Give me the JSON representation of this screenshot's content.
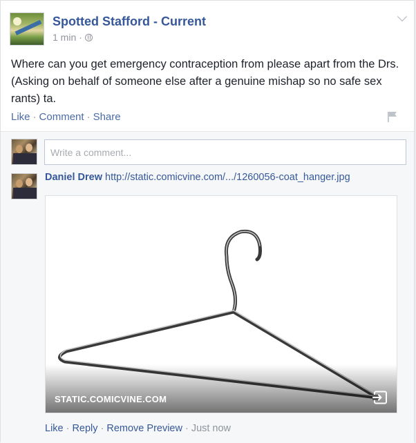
{
  "post": {
    "page_name": "Spotted Stafford - Current",
    "time": "1 min",
    "separator": "·",
    "body": "Where can you get emergency contraception from please apart from the Drs. (Asking on behalf of someone else after a genuine mishap so no safe sex rants) ta.",
    "actions": {
      "like": "Like",
      "comment": "Comment",
      "share": "Share",
      "sep": "·"
    },
    "icons": {
      "privacy": "globe-icon",
      "menu": "chevron-down-icon",
      "report": "flag-icon"
    }
  },
  "comments": {
    "input_placeholder": "Write a comment...",
    "items": [
      {
        "author": "Daniel Drew",
        "link": "http://static.comicvine.com/.../1260056-coat_hanger.jpg",
        "preview": {
          "image": "wire coat hanger",
          "domain": "STATIC.COMICVINE.COM",
          "icon": "share-exit-icon"
        },
        "actions": {
          "like": "Like",
          "reply": "Reply",
          "remove_preview": "Remove Preview",
          "time": "Just now",
          "sep": "·"
        }
      }
    ]
  },
  "colors": {
    "link": "#365899",
    "text": "#1d2129",
    "muted": "#90949c",
    "comments_bg": "#f6f7f9"
  }
}
